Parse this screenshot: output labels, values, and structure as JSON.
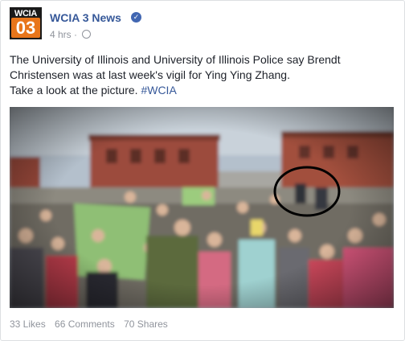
{
  "post": {
    "page_name": "WCIA 3 News",
    "logo_text": "WCIA",
    "logo_number": "03",
    "timestamp": "4 hrs",
    "separator": "·",
    "text_line1": "The University of Illinois and University of Illinois Police say Brendt",
    "text_line2": "Christensen was at last week's vigil for Ying Ying Zhang.",
    "text_line3": "Take a look at the picture.",
    "hashtag": "#WCIA",
    "image_alt": "Photo of a crowd at a vigil with one person circled",
    "icons": [
      "verified-badge-icon",
      "globe-icon"
    ]
  },
  "stats": {
    "likes": "33 Likes",
    "comments": "66 Comments",
    "shares": "70 Shares"
  },
  "colors": {
    "link": "#365899",
    "text": "#1d2129",
    "meta": "#90949c",
    "logo_orange": "#e8751a"
  }
}
